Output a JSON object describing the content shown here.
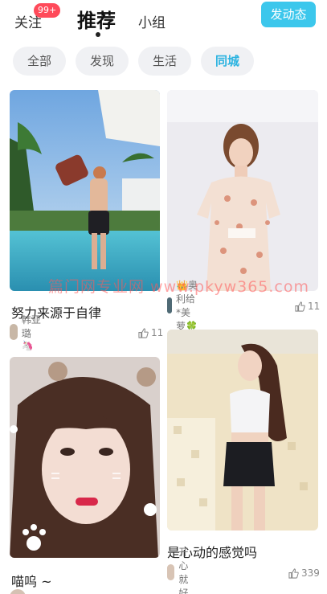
{
  "nav": {
    "follow_label": "关注",
    "follow_badge": "99+",
    "recommend_label": "推荐",
    "group_label": "小组",
    "post_button": "发动态"
  },
  "filters": [
    "全部",
    "发现",
    "生活",
    "同城"
  ],
  "active_filter": "同城",
  "posts": [
    {
      "title": "努力来源于自律",
      "author": "韩亚璐🦄",
      "likes": "11"
    },
    {
      "title": "",
      "author": "👑奥利给*美萝🍀",
      "likes": "11"
    },
    {
      "title": "喵呜 ~",
      "author": "",
      "likes": ""
    },
    {
      "title": "是心动的感觉吗",
      "author": "开心就好",
      "likes": "339"
    }
  ],
  "watermark": "篇门网专业网 www.pkyw365.com",
  "colors": {
    "accent": "#3cc7ec",
    "badge": "#ff4a5a",
    "active_filter": "#2ab3e0"
  }
}
